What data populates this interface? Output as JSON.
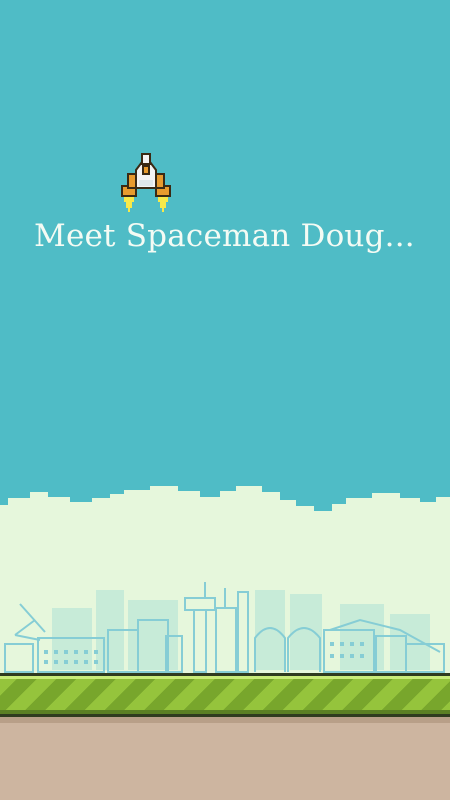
{
  "game": {
    "intro_text": "Meet Spaceman Doug...",
    "character": "spaceman-doug",
    "scene": "city-skyline"
  },
  "colors": {
    "sky": "#4fbcc6",
    "cloud": "#e6f7dc",
    "city_line": "#7ac6cf",
    "grass_light": "#95c43c",
    "grass_dark": "#78a62c",
    "dirt": "#cdb5a0"
  }
}
